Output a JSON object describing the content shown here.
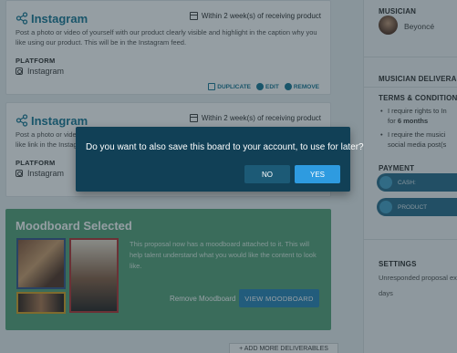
{
  "deliverables": [
    {
      "title": "Instagram",
      "due": "Within 2 week(s) of receiving product",
      "description": "Post a photo or video of yourself with our product clearly visible and highlight in the caption why you like using our product. This will be in the Instagram feed.",
      "platform_label": "PLATFORM",
      "platform": "Instagram",
      "actions": {
        "duplicate": "DUPLICATE",
        "edit": "EDIT",
        "remove": "REMOVE"
      }
    },
    {
      "title": "Instagram",
      "due": "Within 2 week(s) of receiving product",
      "description": "Post a photo or video of yourself with our product clearly visible and highlight in the caption why you like link in the Instagram",
      "platform_label": "PLATFORM",
      "platform": "Instagram"
    }
  ],
  "moodboard": {
    "title": "Moodboard Selected",
    "text": "This proposal now has a moodboard attached to it. This will help talent understand what you would like the content to look like.",
    "remove_label": "Remove Moodboard",
    "view_label": "VIEW MOODBOARD"
  },
  "add_more": "+ ADD MORE DELIVERABLES",
  "sidebar": {
    "musician_label": "MUSICIAN",
    "musician_name": "Beyoncé",
    "deliverables_label": "MUSICIAN DELIVERABLES",
    "terms_label": "TERMS & CONDITIONS",
    "term1_line1": "I require rights to In",
    "term1_line2_prefix": "for ",
    "term1_line2_bold": "6 months",
    "term2_line1": "I require the musici",
    "term2_line2": "social media post(s",
    "payment_label": "PAYMENT",
    "payment_cash": "CASH:",
    "payment_product": "PRODUCT",
    "settings_label": "SETTINGS",
    "settings_text": "Unresponded proposal exp",
    "settings_days": "days"
  },
  "dialog": {
    "message": "Do you want to also save this board to your account, to use for later?",
    "no_label": "NO",
    "yes_label": "YES"
  }
}
